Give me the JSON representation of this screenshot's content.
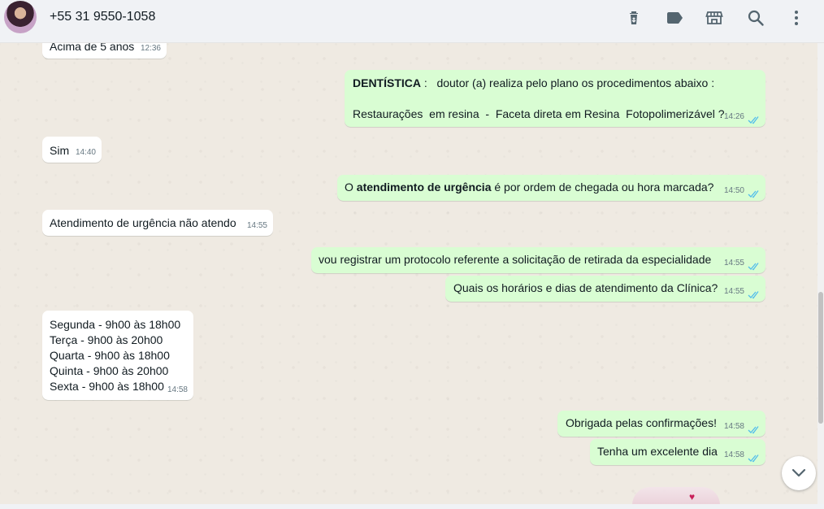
{
  "header": {
    "contact": "+55 31 9550-1058",
    "icons": [
      "delete-icon",
      "label-icon",
      "store-icon",
      "search-icon",
      "menu-icon"
    ]
  },
  "messages": {
    "m0": {
      "text": "Acima de 5 anos",
      "time": "12:36"
    },
    "m1": {
      "bold": "DENTÍSTICA",
      "rest": " :   doutor (a) realiza pelo plano os procedimentos abaixo :",
      "line2": "Restaurações  em resina  -  Faceta direta em Resina  Fotopolimerizável ?",
      "time": "14:26"
    },
    "m2": {
      "text": "Sim",
      "time": "14:40"
    },
    "m3": {
      "pre": "O ",
      "bold": "atendimento de urgência",
      "post": " é por ordem de chegada ou hora marcada?",
      "time": "14:50"
    },
    "m4": {
      "text": "Atendimento de urgência não atendo",
      "time": "14:55"
    },
    "m5": {
      "text": "vou registrar um protocolo referente a solicitação de retirada da especialidade",
      "time": "14:55"
    },
    "m6": {
      "text": "Quais os horários e dias de atendimento da Clínica?",
      "time": "14:55"
    },
    "m7": {
      "lines": [
        "Segunda - 9h00 às 18h00",
        "Terça - 9h00 às 20h00",
        "Quarta - 9h00 às 18h00",
        "Quinta - 9h00 às 20h00",
        "Sexta - 9h00 às 18h00"
      ],
      "time": "14:58"
    },
    "m8": {
      "text": "Obrigada pelas confirmações!",
      "time": "14:58"
    },
    "m9": {
      "text": "Tenha um excelente dia",
      "time": "14:58"
    }
  },
  "colors": {
    "incoming": "#ffffff",
    "outgoing": "#d9fdd3",
    "read_ticks": "#53bdeb",
    "background": "#efeae2"
  }
}
